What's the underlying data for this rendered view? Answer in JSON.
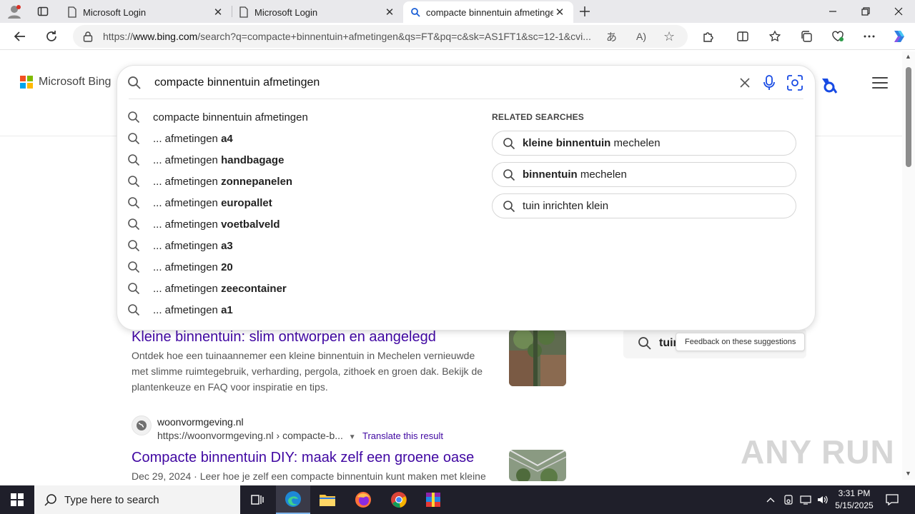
{
  "browser": {
    "tabs": [
      {
        "title": "Microsoft Login",
        "favicon": "page-icon"
      },
      {
        "title": "Microsoft Login",
        "favicon": "page-icon"
      },
      {
        "title": "compacte binnentuin afmetingen",
        "favicon": "search-icon"
      }
    ],
    "url_prefix": "https://",
    "url_host": "www.bing.com",
    "url_rest": "/search?q=compacte+binnentuin+afmetingen&qs=FT&pq=c&sk=AS1FT1&sc=12-1&cvi..."
  },
  "bing": {
    "logo_text": "Microsoft Bing",
    "query": "compacte binnentuin afmetingen",
    "suggestions": [
      {
        "prefix": "compacte binnentuin afmetingen",
        "bold": ""
      },
      {
        "prefix": "... afmetingen ",
        "bold": "a4"
      },
      {
        "prefix": "... afmetingen ",
        "bold": "handbagage"
      },
      {
        "prefix": "... afmetingen ",
        "bold": "zonnepanelen"
      },
      {
        "prefix": "... afmetingen ",
        "bold": "europallet"
      },
      {
        "prefix": "... afmetingen ",
        "bold": "voetbalveld"
      },
      {
        "prefix": "... afmetingen ",
        "bold": "a3"
      },
      {
        "prefix": "... afmetingen ",
        "bold": "20"
      },
      {
        "prefix": "... afmetingen ",
        "bold": "zeecontainer"
      },
      {
        "prefix": "... afmetingen ",
        "bold": "a1"
      }
    ],
    "related_title": "RELATED SEARCHES",
    "related": [
      {
        "bold": "kleine binnentuin",
        "rest": " mechelen"
      },
      {
        "bold": "binnentuin",
        "rest": " mechelen"
      },
      {
        "bold": "",
        "rest": "tuin inrichten klein"
      }
    ],
    "feedback": "Feedback on these suggestions",
    "right_search_text": "tuin"
  },
  "results": [
    {
      "title": "Kleine binnentuin: slim ontworpen en aangelegd",
      "snippet": "Ontdek hoe een tuinaannemer een kleine binnentuin in Mechelen vernieuwde met slimme ruimtegebruik, verharding, pergola, zithoek en groen dak. Bekijk de plantenkeuze en FAQ voor inspiratie en tips."
    },
    {
      "site_name": "woonvormgeving.nl",
      "site_url": "https://woonvormgeving.nl › compacte-b...",
      "translate": "Translate this result",
      "title": "Compacte binnentuin DIY: maak zelf een groene oase",
      "snippet": "Dec 29, 2024 · Leer hoe je zelf een compacte binnentuin kunt maken met kleine"
    }
  ],
  "watermark": "ANY RUN",
  "taskbar": {
    "search_placeholder": "Type here to search",
    "time": "3:31 PM",
    "date": "5/15/2025",
    "apps": [
      "task-view-icon",
      "edge-icon",
      "file-explorer-icon",
      "firefox-icon",
      "chrome-icon",
      "winrar-icon"
    ]
  },
  "colors": {
    "link_title": "#4007a2",
    "bing_blue": "#174ae4",
    "taskbar_bg": "#1f1f2a",
    "ms_red": "#f25022",
    "ms_green": "#7fba00",
    "ms_blue": "#00a4ef",
    "ms_yellow": "#ffb900"
  }
}
